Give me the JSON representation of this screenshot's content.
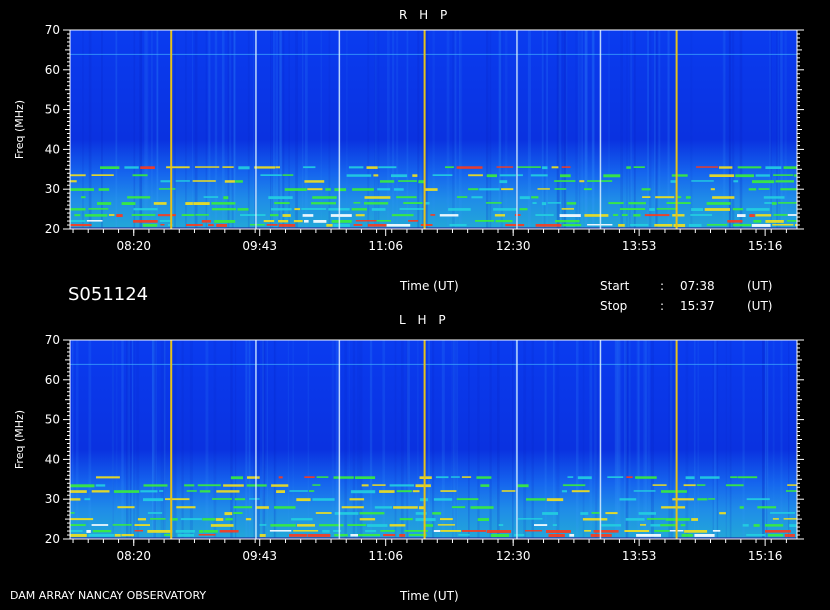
{
  "code": "S051124",
  "footer_left": "DAM ARRAY   NANCAY OBSERVATORY",
  "xlabel_mid": "Time (UT)",
  "xlabel_bottom": "Time (UT)",
  "start": {
    "label": "Start",
    "sep": ":",
    "value": "07:38",
    "unit": "(UT)"
  },
  "stop": {
    "label": "Stop",
    "sep": ":",
    "value": "15:37",
    "unit": "(UT)"
  },
  "colors": {
    "background": "#000000",
    "base": "#0a2ee6",
    "marker_yellow": "#e6c21a",
    "marker_white": "#d8f0ff"
  },
  "chart_data": [
    {
      "type": "heatmap",
      "title": "R H P",
      "xlabel": "Time (UT)",
      "ylabel": "Freq (MHz)",
      "xlim": [
        "07:38",
        "15:37"
      ],
      "ylim": [
        20,
        70
      ],
      "x_ticks": [
        "08:20",
        "09:43",
        "11:06",
        "12:30",
        "13:53",
        "15:16"
      ],
      "y_ticks": [
        20,
        30,
        40,
        50,
        60,
        70
      ],
      "yellow_markers": [
        "08:44",
        "11:31",
        "14:17"
      ],
      "white_markers": [
        "09:40",
        "10:35",
        "12:32",
        "13:27"
      ]
    },
    {
      "type": "heatmap",
      "title": "L H P",
      "xlabel": "Time (UT)",
      "ylabel": "Freq (MHz)",
      "xlim": [
        "07:38",
        "15:37"
      ],
      "ylim": [
        20,
        70
      ],
      "x_ticks": [
        "08:20",
        "09:43",
        "11:06",
        "12:30",
        "13:53",
        "15:16"
      ],
      "y_ticks": [
        20,
        30,
        40,
        50,
        60,
        70
      ],
      "yellow_markers": [
        "08:44",
        "11:31",
        "14:17"
      ],
      "white_markers": [
        "09:40",
        "10:35",
        "12:32",
        "13:27"
      ]
    }
  ]
}
